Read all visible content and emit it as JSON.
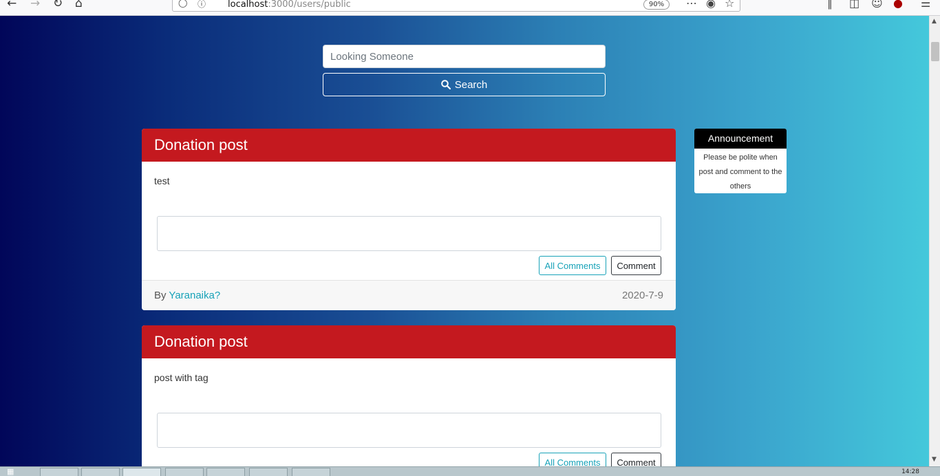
{
  "browser": {
    "url_host": "localhost",
    "url_path": ":3000/users/public",
    "zoom": "90%",
    "icons": [
      "back-icon",
      "forward-icon",
      "reload-icon",
      "home-icon",
      "site-info-icon",
      "more-icon",
      "pocket-icon",
      "bookmark-star-icon",
      "library-icon",
      "sidebar-icon",
      "account-icon",
      "extension-icon",
      "menu-icon"
    ]
  },
  "search": {
    "placeholder": "Looking Someone",
    "button_label": "Search",
    "button_icon": "search-icon"
  },
  "posts": [
    {
      "title": "Donation post",
      "content": "test",
      "all_comments_label": "All Comments",
      "comment_label": "Comment",
      "by_label": "By",
      "author": "Yaranaika?",
      "date": "2020-7-9"
    },
    {
      "title": "Donation post",
      "content": "post with tag",
      "all_comments_label": "All Comments",
      "comment_label": "Comment"
    }
  ],
  "announcement": {
    "title": "Announcement",
    "body": "Please be polite when post and comment to the others"
  },
  "taskbar": {
    "clock": "14:28"
  }
}
